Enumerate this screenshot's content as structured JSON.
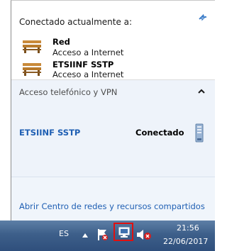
{
  "panel": {
    "header": "Conectado actualmente a:",
    "networks": [
      {
        "name": "Red",
        "status": "Acceso a Internet",
        "icon": "bench-network-icon"
      },
      {
        "name": "ETSIINF SSTP",
        "status": "Acceso a Internet",
        "icon": "bench-network-icon"
      }
    ],
    "refresh_icon": "refresh-icon"
  },
  "vpn_section": {
    "title": "Acceso telefónico y VPN",
    "collapse_icon": "chevron-up-icon",
    "connection": {
      "name": "ETSIINF SSTP",
      "status": "Conectado",
      "icon": "vpn-server-icon"
    }
  },
  "footer": {
    "link": "Abrir Centro de redes y recursos compartidos"
  },
  "taskbar": {
    "language": "ES",
    "time": "21:56",
    "date": "22/06/2017",
    "icons": [
      "show-hidden-icons-icon",
      "action-center-flag-icon",
      "network-tray-icon",
      "volume-muted-icon"
    ]
  },
  "colors": {
    "link": "#1f5fb3",
    "taskbar": "#3d5f8a",
    "highlight": "#e01010"
  }
}
